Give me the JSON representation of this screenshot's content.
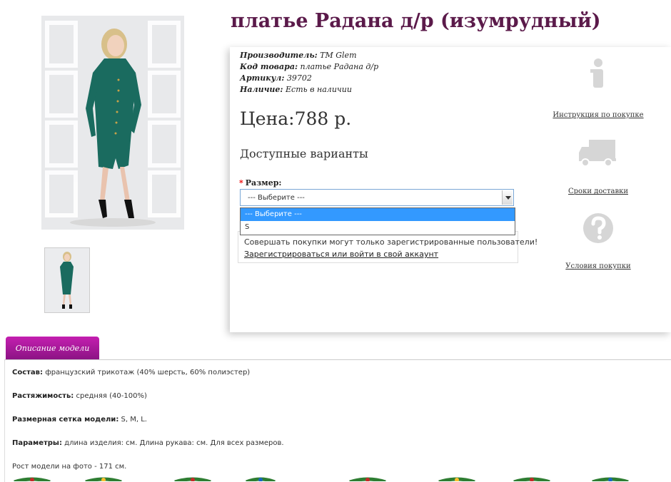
{
  "product": {
    "title": "платье Радана д/р (изумрудный)",
    "image_alt": "Женщина в изумрудном платье",
    "manufacturer_label": "Производитель:",
    "manufacturer": "TM Glem",
    "code_label": "Код товара:",
    "code": "платье Радана д/р",
    "article_label": "Артикул:",
    "article": "39702",
    "availability_label": "Наличие:",
    "availability": "Есть в наличии",
    "price": "Цена:788 р.",
    "variants_title": "Доступные варианты",
    "size_label": "Размер:",
    "size_select_value": "--- Выберите ---",
    "size_options": [
      "--- Выберите ---",
      "S"
    ],
    "notice_text": "Совершать покупки могут только зарегистрированные пользователи!",
    "notice_link": "Зарегистрироваться или войти в свой аккаунт",
    "dress_color": "#1a6b5f"
  },
  "sidebar": {
    "items": [
      {
        "label": "Инструкция по покупке",
        "icon": "info-icon"
      },
      {
        "label": "Сроки доставки",
        "icon": "truck-icon"
      },
      {
        "label": "Условия покупки",
        "icon": "question-icon"
      }
    ],
    "icon_color": "#d6d6d6"
  },
  "tabs": {
    "description": "Описание модели",
    "tab_color": "#a3169a"
  },
  "description": {
    "composition_label": "Состав:",
    "composition": "французский трикотаж (40% шерсть, 60% полиэстер)",
    "stretch_label": "Растяжимость:",
    "stretch": "средняя (40-100%)",
    "sizes_label": "Размерная сетка модели:",
    "sizes": "S, M, L.",
    "params_label": "Параметры:",
    "params": "длина изделия: см. Длина рукава: см. Для всех размеров.",
    "model_height": "Рост модели на фото - 171 см."
  },
  "title_color": "#5b1a4a"
}
